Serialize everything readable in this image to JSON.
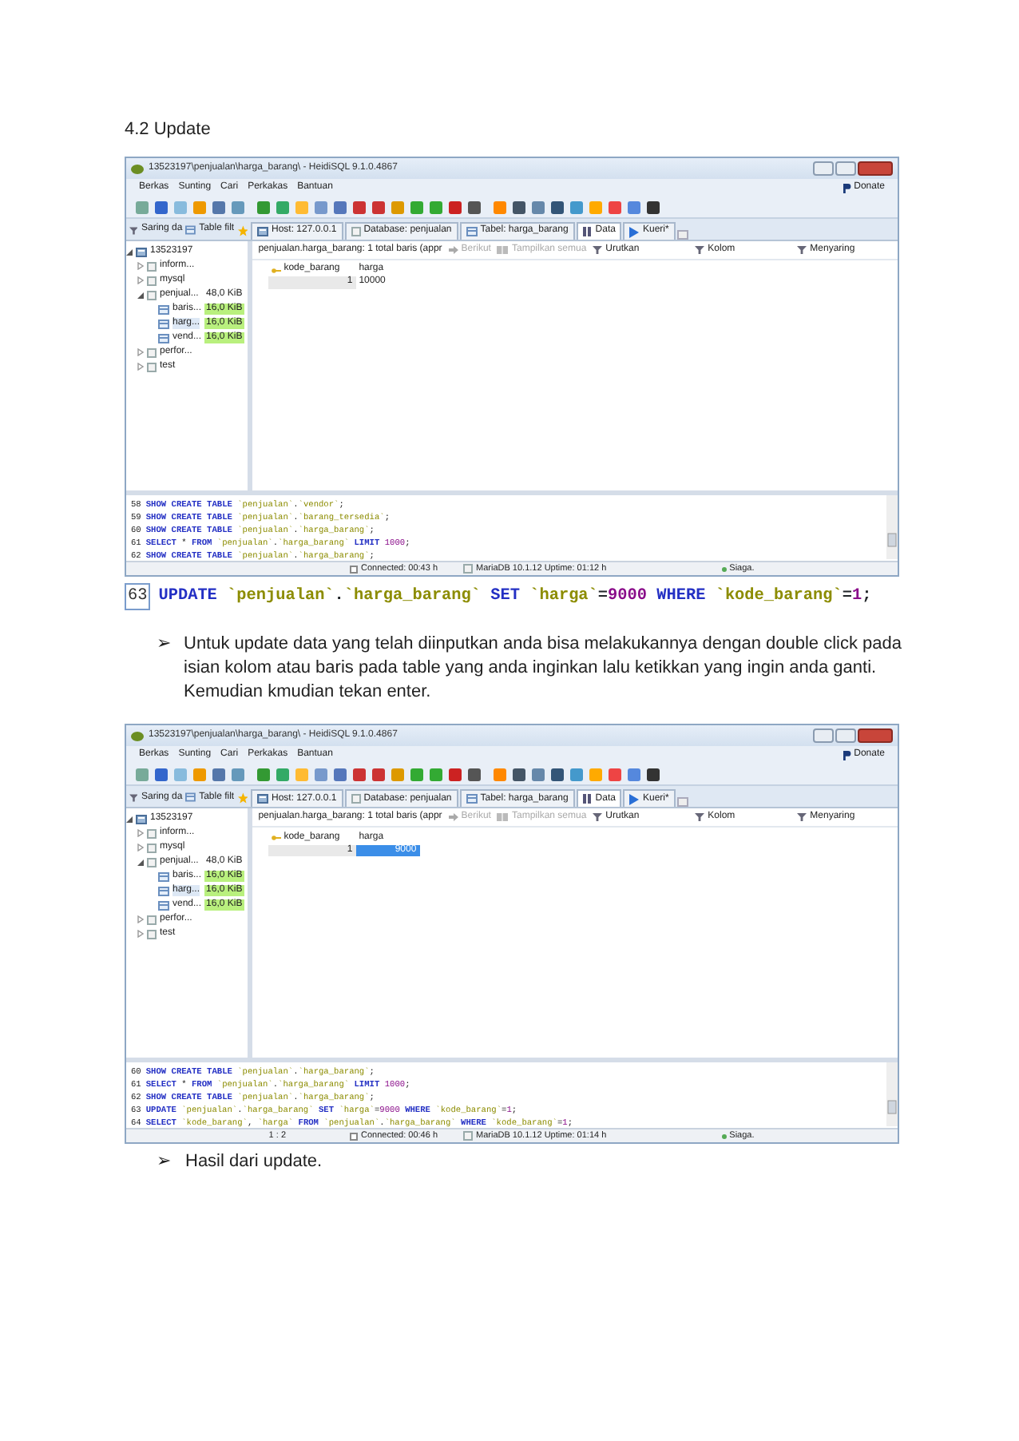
{
  "heading": "4.2 Update",
  "content": [
    {
      "kind": "screenshot",
      "window": {
        "title": "13523197\\penjualan\\harga_barang\\ - HeidiSQL 9.1.0.4867",
        "menu": [
          "Berkas",
          "Sunting",
          "Cari",
          "Perkakas",
          "Bantuan"
        ],
        "donate": "Donate",
        "filter_tabs": [
          "Saring da",
          "Table filt"
        ],
        "tabs": [
          {
            "kind": "host",
            "label": "Host: 127.0.0.1",
            "selected": false
          },
          {
            "kind": "database",
            "label": "Database: penjualan",
            "selected": false
          },
          {
            "kind": "table",
            "label": "Tabel: harga_barang",
            "selected": false
          },
          {
            "kind": "data",
            "label": "Data",
            "selected": true
          },
          {
            "kind": "query",
            "label": "Kueri*",
            "selected": false
          }
        ],
        "tree": [
          {
            "kind": "server",
            "label": "13523197",
            "selected": false,
            "expanded": true,
            "children": [
              {
                "kind": "database",
                "label": "inform...",
                "selected": false,
                "expanded": false
              },
              {
                "kind": "database",
                "label": "mysql",
                "selected": false,
                "expanded": false
              },
              {
                "kind": "database",
                "label": "penjual...",
                "size": "48,0 KiB",
                "selected": false,
                "expanded": true,
                "children": [
                  {
                    "kind": "table",
                    "label": "baris...",
                    "size": "16,0 KiB",
                    "selected": false
                  },
                  {
                    "kind": "table",
                    "label": "harg...",
                    "size": "16,0 KiB",
                    "selected": true
                  },
                  {
                    "kind": "table",
                    "label": "vend...",
                    "size": "16,0 KiB",
                    "selected": false
                  }
                ]
              },
              {
                "kind": "database",
                "label": "perfor...",
                "selected": false,
                "expanded": false
              },
              {
                "kind": "database",
                "label": "test",
                "selected": false,
                "expanded": false
              }
            ]
          }
        ],
        "data_toolbar": [
          {
            "kind": "summary",
            "label": "penjualan.harga_barang: 1 total baris (appr",
            "disabled": false
          },
          {
            "kind": "next",
            "label": "Berikut",
            "disabled": true
          },
          {
            "kind": "show_all",
            "label": "Tampilkan semua",
            "disabled": true
          },
          {
            "kind": "filter",
            "label": "Urutkan",
            "disabled": false
          },
          {
            "kind": "filter",
            "label": "Kolom",
            "disabled": false
          },
          {
            "kind": "filter",
            "label": "Menyaring",
            "disabled": false
          }
        ],
        "grid": {
          "columns": [
            "kode_barang",
            "harga"
          ],
          "rows": [
            {
              "cells": [
                {
                  "text": "1",
                  "selected": false
                },
                {
                  "text": "10000",
                  "selected": false
                }
              ]
            }
          ]
        },
        "log": [
          {
            "number": "58",
            "sql": "SHOW CREATE TABLE `penjualan`.`vendor`;"
          },
          {
            "number": "59",
            "sql": "SHOW CREATE TABLE `penjualan`.`barang_tersedia`;"
          },
          {
            "number": "60",
            "sql": "SHOW CREATE TABLE `penjualan`.`harga_barang`;"
          },
          {
            "number": "61",
            "sql": "SELECT * FROM `penjualan`.`harga_barang` LIMIT 1000;"
          },
          {
            "number": "62",
            "sql": "SHOW CREATE TABLE `penjualan`.`harga_barang`;"
          }
        ],
        "status": {
          "connected": "Connected: 00:43 h",
          "server": "MariaDB 10.1.12 Uptime: 01:12 h",
          "state": "Siaga."
        }
      }
    },
    {
      "kind": "code",
      "number": "63",
      "code": "UPDATE `penjualan`.`harga_barang` SET `harga`=9000 WHERE  `kode_barang`=1;"
    },
    {
      "kind": "bullet",
      "marker": "➢",
      "lines": [
        "Untuk update data yang telah diinputkan anda bisa melakukannya dengan double click pada isian kolom atau baris pada table yang anda inginkan lalu ketikkan yang ingin anda ganti.",
        "Kemudian kmudian tekan enter."
      ]
    },
    {
      "kind": "screenshot",
      "window": {
        "title": "13523197\\penjualan\\harga_barang\\ - HeidiSQL 9.1.0.4867",
        "menu": [
          "Berkas",
          "Sunting",
          "Cari",
          "Perkakas",
          "Bantuan"
        ],
        "donate": "Donate",
        "filter_tabs": [
          "Saring da",
          "Table filt"
        ],
        "tabs": [
          {
            "kind": "host",
            "label": "Host: 127.0.0.1",
            "selected": false
          },
          {
            "kind": "database",
            "label": "Database: penjualan",
            "selected": false
          },
          {
            "kind": "table",
            "label": "Tabel: harga_barang",
            "selected": false
          },
          {
            "kind": "data",
            "label": "Data",
            "selected": true
          },
          {
            "kind": "query",
            "label": "Kueri*",
            "selected": false
          }
        ],
        "tree": [
          {
            "kind": "server",
            "label": "13523197",
            "selected": false,
            "expanded": true,
            "children": [
              {
                "kind": "database",
                "label": "inform...",
                "selected": false,
                "expanded": false
              },
              {
                "kind": "database",
                "label": "mysql",
                "selected": false,
                "expanded": false
              },
              {
                "kind": "database",
                "label": "penjual...",
                "size": "48,0 KiB",
                "selected": false,
                "expanded": true,
                "children": [
                  {
                    "kind": "table",
                    "label": "baris...",
                    "size": "16,0 KiB",
                    "selected": false
                  },
                  {
                    "kind": "table",
                    "label": "harg...",
                    "size": "16,0 KiB",
                    "selected": true
                  },
                  {
                    "kind": "table",
                    "label": "vend...",
                    "size": "16,0 KiB",
                    "selected": false
                  }
                ]
              },
              {
                "kind": "database",
                "label": "perfor...",
                "selected": false,
                "expanded": false
              },
              {
                "kind": "database",
                "label": "test",
                "selected": false,
                "expanded": false
              }
            ]
          }
        ],
        "data_toolbar": [
          {
            "kind": "summary",
            "label": "penjualan.harga_barang: 1 total baris (appr",
            "disabled": false
          },
          {
            "kind": "next",
            "label": "Berikut",
            "disabled": true
          },
          {
            "kind": "show_all",
            "label": "Tampilkan semua",
            "disabled": true
          },
          {
            "kind": "filter",
            "label": "Urutkan",
            "disabled": false
          },
          {
            "kind": "filter",
            "label": "Kolom",
            "disabled": false
          },
          {
            "kind": "filter",
            "label": "Menyaring",
            "disabled": false
          }
        ],
        "grid": {
          "columns": [
            "kode_barang",
            "harga"
          ],
          "rows": [
            {
              "cells": [
                {
                  "text": "1",
                  "selected": false
                },
                {
                  "text": "9000",
                  "selected": true
                }
              ]
            }
          ]
        },
        "log": [
          {
            "number": "60",
            "sql": "SHOW CREATE TABLE `penjualan`.`harga_barang`;"
          },
          {
            "number": "61",
            "sql": "SELECT * FROM `penjualan`.`harga_barang` LIMIT 1000;"
          },
          {
            "number": "62",
            "sql": "SHOW CREATE TABLE `penjualan`.`harga_barang`;"
          },
          {
            "number": "63",
            "sql": "UPDATE `penjualan`.`harga_barang` SET `harga`=9000 WHERE  `kode_barang`=1;"
          },
          {
            "number": "64",
            "sql": "SELECT `kode_barang`, `harga` FROM `penjualan`.`harga_barang` WHERE  `kode_barang`=1;"
          }
        ],
        "status": {
          "position": "1 : 2",
          "connected": "Connected: 00:46 h",
          "server": "MariaDB 10.1.12 Uptime: 01:14 h",
          "state": "Siaga."
        }
      }
    },
    {
      "kind": "bullet",
      "marker": "➢",
      "lines": [
        "Hasil dari update."
      ]
    }
  ]
}
